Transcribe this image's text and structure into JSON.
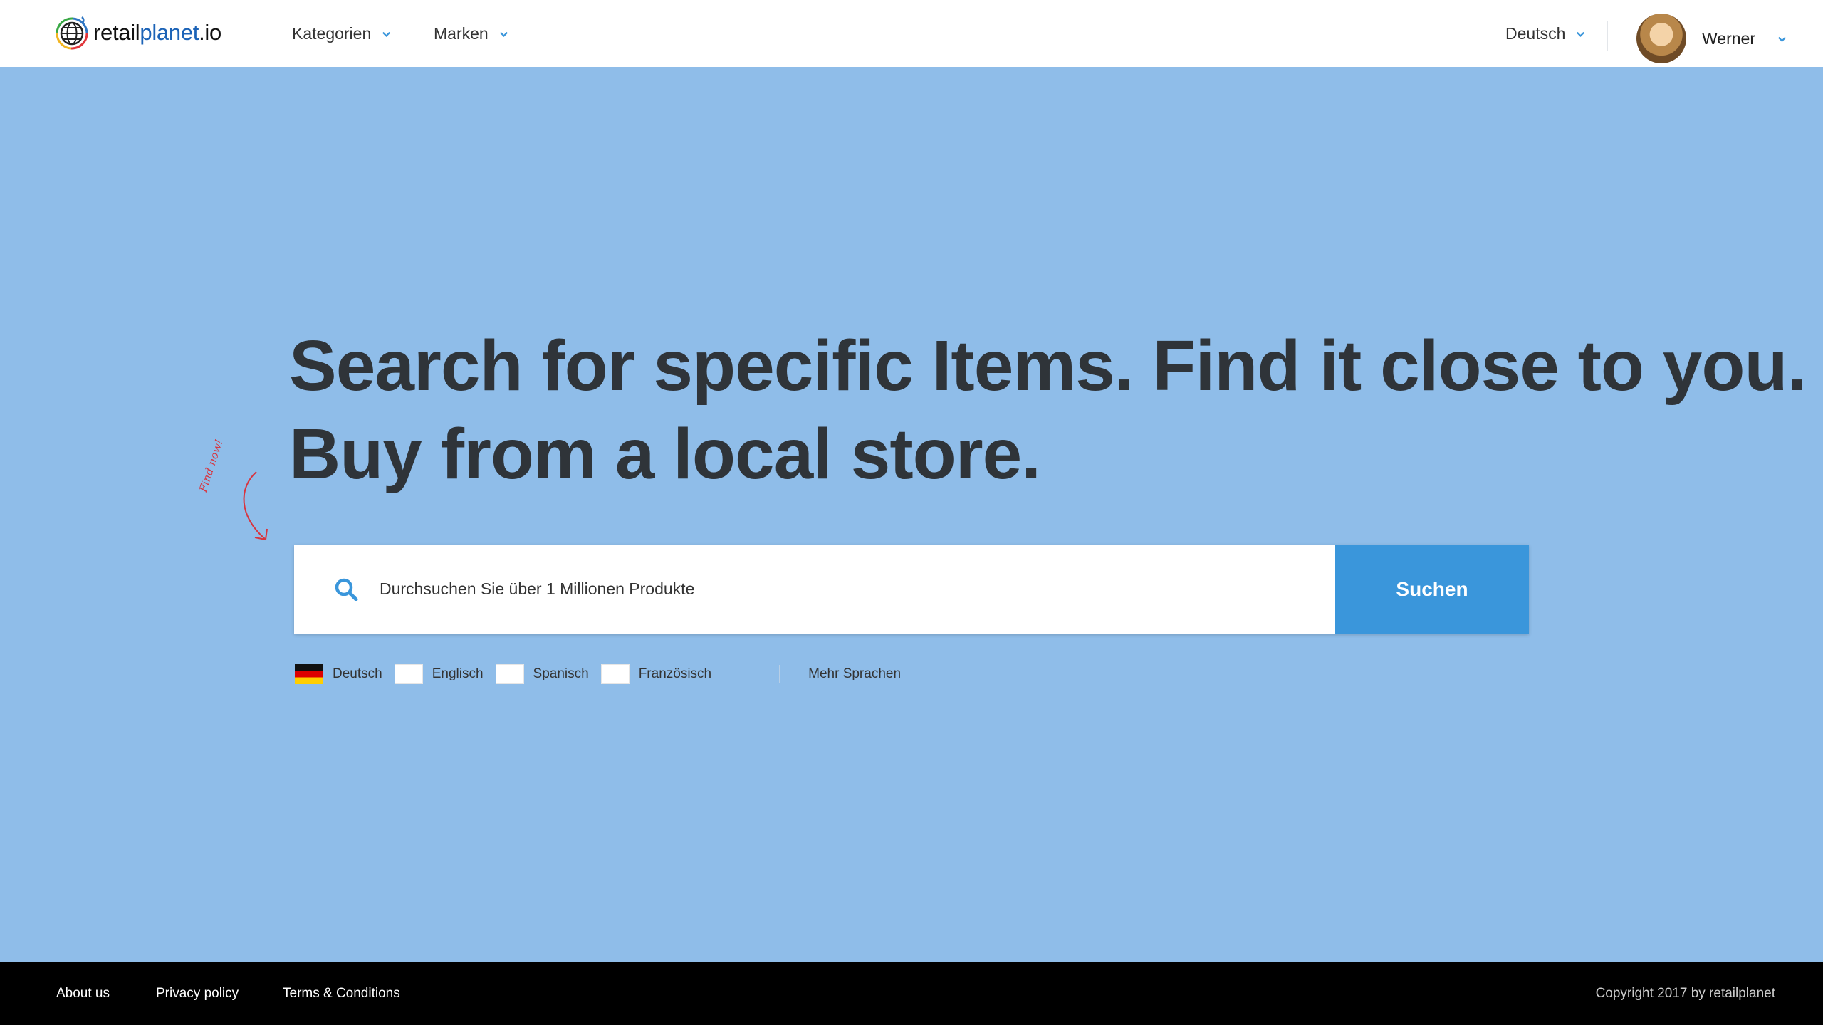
{
  "logo": {
    "part1": "retail",
    "part2": "planet",
    "part3": ".io"
  },
  "nav": {
    "categories_label": "Kategorien",
    "brands_label": "Marken",
    "language_label": "Deutsch"
  },
  "user": {
    "name": "Werner"
  },
  "hero": {
    "headline_light": "Search for specific Items. Find it close to you.",
    "headline_bold": "Buy from a local store.",
    "annotation": "Find now!"
  },
  "search": {
    "placeholder": "Durchsuchen Sie über 1 Millionen Produkte",
    "button_label": "Suchen"
  },
  "languages": {
    "options": [
      {
        "label": "Deutsch",
        "flag": "de-flag-icon"
      },
      {
        "label": "Englisch"
      },
      {
        "label": "Spanisch"
      },
      {
        "label": "Französisch"
      }
    ],
    "more_label": "Mehr Sprachen"
  },
  "footer": {
    "about": "About us",
    "privacy": "Privacy policy",
    "terms": "Terms & Conditions",
    "copyright": "Copyright 2017 by retailplanet"
  },
  "colors": {
    "background": "#8fbde9",
    "accent": "#3a96db",
    "headline": "#2f3439",
    "footer": "#000000"
  }
}
